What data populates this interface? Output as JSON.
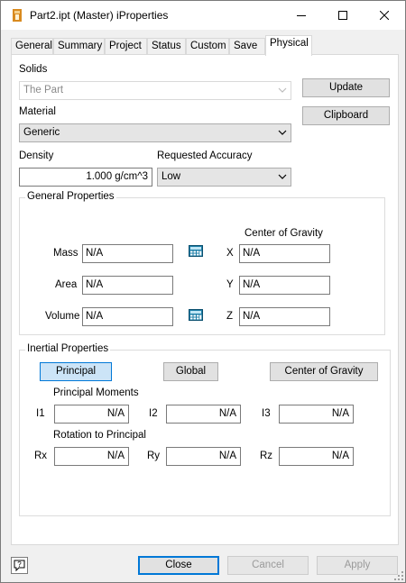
{
  "window": {
    "title": "Part2.ipt (Master) iProperties",
    "minimize_glyph": "—",
    "maximize_glyph": "☐",
    "close_glyph": "✕"
  },
  "tabs": [
    {
      "label": "General",
      "active": false
    },
    {
      "label": "Summary",
      "active": false
    },
    {
      "label": "Project",
      "active": false
    },
    {
      "label": "Status",
      "active": false
    },
    {
      "label": "Custom",
      "active": false
    },
    {
      "label": "Save",
      "active": false
    },
    {
      "label": "Physical",
      "active": true
    }
  ],
  "physical": {
    "solids_label": "Solids",
    "solids_value": "The Part",
    "update_label": "Update",
    "material_label": "Material",
    "material_value": "Generic",
    "clipboard_label": "Clipboard",
    "density_label": "Density",
    "density_value": "1.000 g/cm^3",
    "accuracy_label": "Requested Accuracy",
    "accuracy_value": "Low",
    "general_props": {
      "title": "General Properties",
      "cog_title": "Center of Gravity",
      "mass_label": "Mass",
      "mass_value": "N/A",
      "area_label": "Area",
      "area_value": "N/A",
      "volume_label": "Volume",
      "volume_value": "N/A",
      "x_label": "X",
      "x_value": "N/A",
      "y_label": "Y",
      "y_value": "N/A",
      "z_label": "Z",
      "z_value": "N/A"
    },
    "inertial_props": {
      "title": "Inertial Properties",
      "principal_label": "Principal",
      "global_label": "Global",
      "cog_label": "Center of Gravity",
      "moments_title": "Principal Moments",
      "i1_label": "I1",
      "i1_value": "N/A",
      "i2_label": "I2",
      "i2_value": "N/A",
      "i3_label": "I3",
      "i3_value": "N/A",
      "rotation_title": "Rotation to Principal",
      "rx_label": "Rx",
      "rx_value": "N/A",
      "ry_label": "Ry",
      "ry_value": "N/A",
      "rz_label": "Rz",
      "rz_value": "N/A"
    }
  },
  "footer": {
    "help_glyph": "?",
    "close_label": "Close",
    "cancel_label": "Cancel",
    "apply_label": "Apply"
  },
  "colors": {
    "accent": "#0078d7",
    "selected_button": "#cce4f7"
  }
}
